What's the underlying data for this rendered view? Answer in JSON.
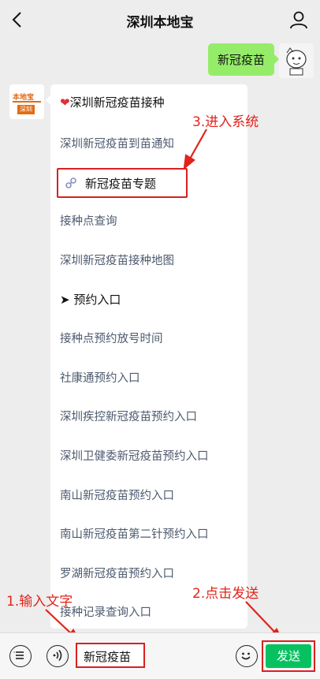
{
  "header": {
    "title": "深圳本地宝"
  },
  "me_message": {
    "text": "新冠疫苗"
  },
  "bot": {
    "avatar_brand": "本地宝",
    "avatar_sub": "深圳",
    "card_title": "深圳新冠疫苗接种",
    "links": [
      "深圳新冠疫苗到苗通知",
      "新冠疫苗专题",
      "接种点查询",
      "深圳新冠疫苗接种地图",
      "➤ 预约入口",
      "接种点预约放号时间",
      "社康通预约入口",
      "深圳疾控新冠疫苗预约入口",
      "深圳卫健委新冠疫苗预约入口",
      "南山新冠疫苗预约入口",
      "南山新冠疫苗第二针预约入口",
      "罗湖新冠疫苗预约入口",
      "接种记录查询入口"
    ]
  },
  "annotations": {
    "step1": "1.输入文字",
    "step2": "2.点击发送",
    "step3": "3.进入系统"
  },
  "input": {
    "value": "新冠疫苗",
    "send_label": "发送"
  },
  "colors": {
    "accent_red": "#e2231a",
    "send_green": "#07c160",
    "bubble_green": "#95ec69"
  }
}
